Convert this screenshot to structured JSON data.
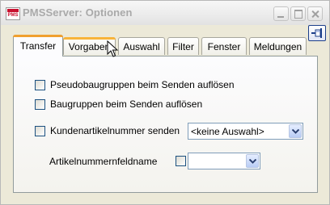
{
  "window": {
    "title": "PMSServer: Optionen",
    "app_icon_text": "PMS",
    "controls": [
      "minimize-icon",
      "maximize-icon",
      "close-icon"
    ],
    "pin_icon": "pin-icon"
  },
  "tabs": [
    {
      "label": "Transfer",
      "active": true
    },
    {
      "label": "Vorgaben",
      "active": false,
      "hover": true
    },
    {
      "label": "Auswahl",
      "active": false
    },
    {
      "label": "Filter",
      "active": false
    },
    {
      "label": "Fenster",
      "active": false
    },
    {
      "label": "Meldungen",
      "active": false
    }
  ],
  "transfer": {
    "pseudo": {
      "label": "Pseudobaugruppen beim Senden auflösen",
      "checked": false
    },
    "baugruppen": {
      "label": "Baugruppen beim Senden auflösen",
      "checked": false
    },
    "kundenart": {
      "label": "Kundenartikelnummer senden",
      "checked": false,
      "combo_value": "<keine Auswahl>"
    },
    "feldname": {
      "label": "Artikelnummernfeldname",
      "checked": false,
      "combo_value": ""
    }
  },
  "colors": {
    "accent_tab": "#f0a030",
    "control_border": "#1c5180",
    "combo_button": "#b8ccf5"
  }
}
